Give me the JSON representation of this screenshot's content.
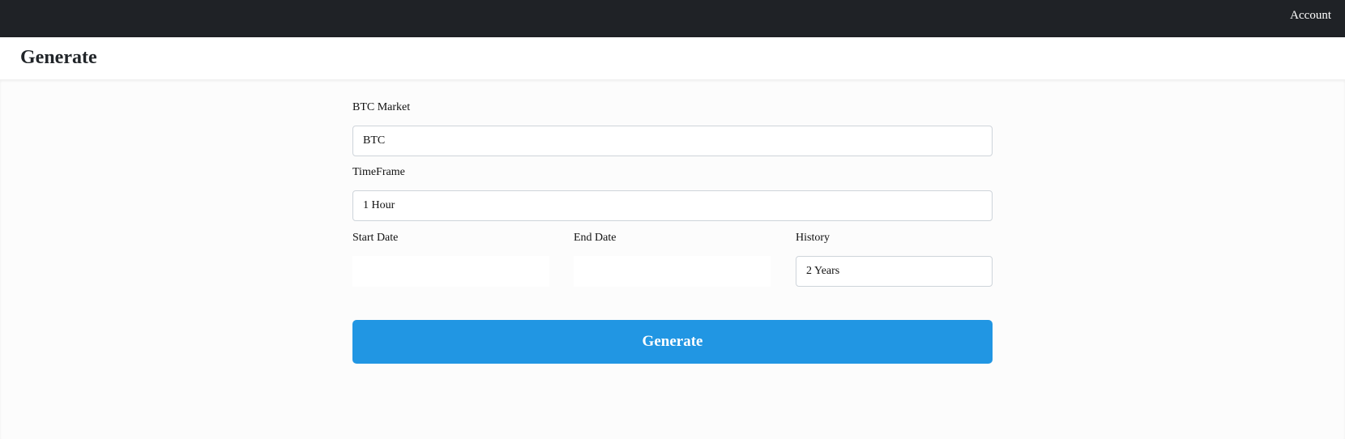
{
  "topbar": {
    "account_label": "Account",
    "background": "#1f2226"
  },
  "header": {
    "title": "Generate"
  },
  "form": {
    "market": {
      "label": "BTC Market",
      "value": "BTC"
    },
    "timeframe": {
      "label": "TimeFrame",
      "value": "1 Hour"
    },
    "start_date": {
      "label": "Start Date",
      "value": ""
    },
    "end_date": {
      "label": "End Date",
      "value": ""
    },
    "history": {
      "label": "History",
      "value": "2 Years"
    },
    "generate_label": "Generate",
    "accent_color": "#2196e3"
  }
}
